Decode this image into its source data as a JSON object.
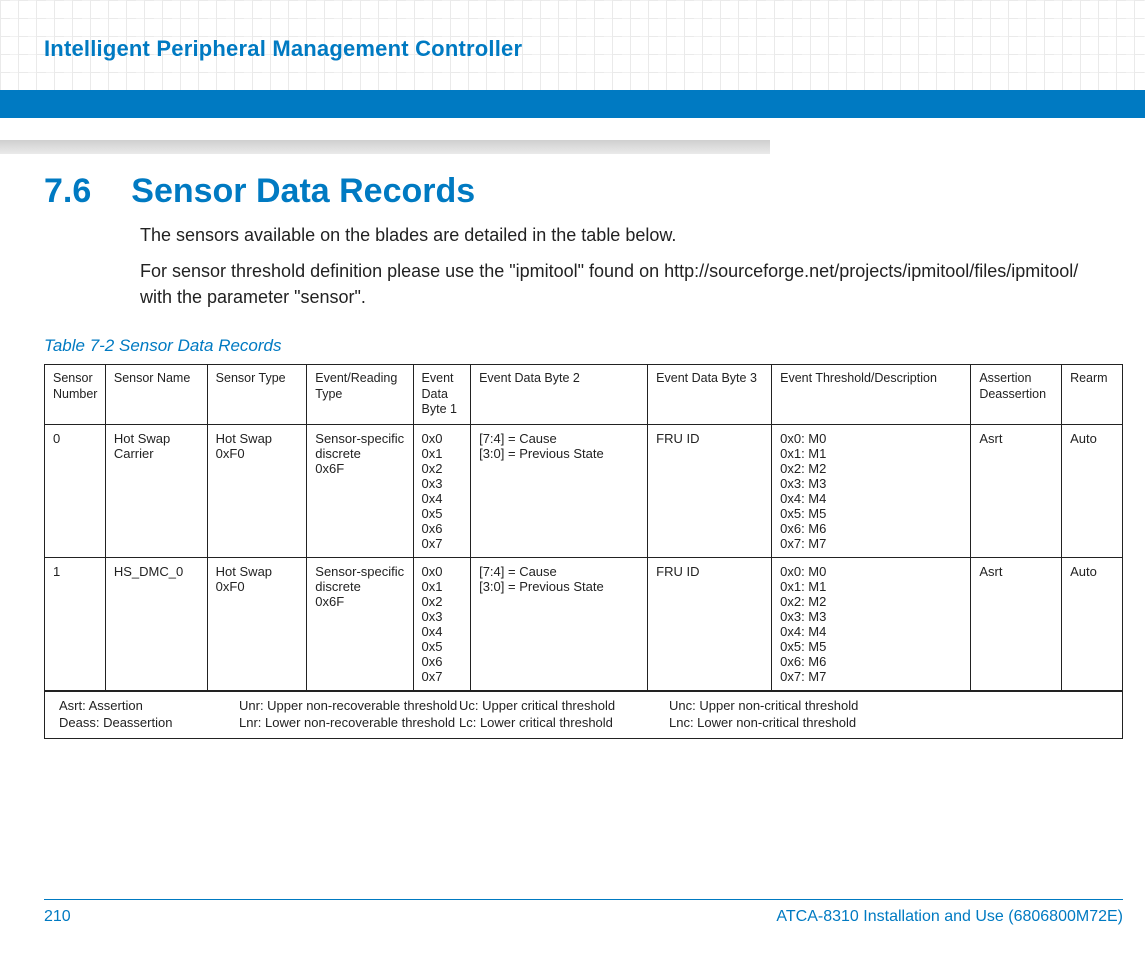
{
  "header": {
    "chapter_title": "Intelligent Peripheral Management Controller"
  },
  "section": {
    "number": "7.6",
    "title": "Sensor Data Records"
  },
  "paragraphs": {
    "p1": "The sensors available on the blades are detailed in the table below.",
    "p2": "For sensor threshold definition please use the \"ipmitool\" found on http://sourceforge.net/projects/ipmitool/files/ipmitool/ with the parameter \"sensor\"."
  },
  "table": {
    "caption": "Table 7-2 Sensor Data Records",
    "headers": {
      "c1": "Sensor Number",
      "c2": "Sensor Name",
      "c3": "Sensor Type",
      "c4": "Event/Reading Type",
      "c5": "Event Data Byte 1",
      "c6": "Event Data Byte 2",
      "c7": "Event Data Byte 3",
      "c8": "Event Threshold/Description",
      "c9": "Assertion Deassertion",
      "c10": "Rearm"
    },
    "rows": [
      {
        "c1": "0",
        "c2": "Hot Swap Carrier",
        "c3": "Hot Swap\n0xF0",
        "c4": "Sensor-specific discrete\n0x6F",
        "c5": "0x0\n0x1\n0x2\n0x3\n0x4\n0x5\n0x6\n0x7",
        "c6": "[7:4] = Cause\n[3:0] = Previous State",
        "c7": "FRU ID",
        "c8": "0x0: M0\n0x1: M1\n0x2: M2\n0x3: M3\n0x4: M4\n0x5: M5\n0x6: M6\n0x7: M7",
        "c9": "Asrt",
        "c10": "Auto"
      },
      {
        "c1": "1",
        "c2": "HS_DMC_0",
        "c3": "Hot Swap\n0xF0",
        "c4": "Sensor-specific discrete\n0x6F",
        "c5": "0x0\n0x1\n0x2\n0x3\n0x4\n0x5\n0x6\n0x7",
        "c6": "[7:4] = Cause\n[3:0] = Previous State",
        "c7": "FRU ID",
        "c8": "0x0: M0\n0x1: M1\n0x2: M2\n0x3: M3\n0x4: M4\n0x5: M5\n0x6: M6\n0x7: M7",
        "c9": "Asrt",
        "c10": "Auto"
      }
    ],
    "legend": {
      "a1": "Asrt: Assertion",
      "a2": "Unr: Upper non-recoverable threshold",
      "a3": "Uc: Upper critical threshold",
      "a4": "Unc: Upper non-critical threshold",
      "b1": "Deass: Deassertion",
      "b2": "Lnr: Lower non-recoverable threshold",
      "b3": "Lc: Lower critical threshold",
      "b4": "Lnc: Lower non-critical threshold"
    }
  },
  "footer": {
    "page": "210",
    "doc": "ATCA-8310 Installation and Use (6806800M72E)"
  }
}
